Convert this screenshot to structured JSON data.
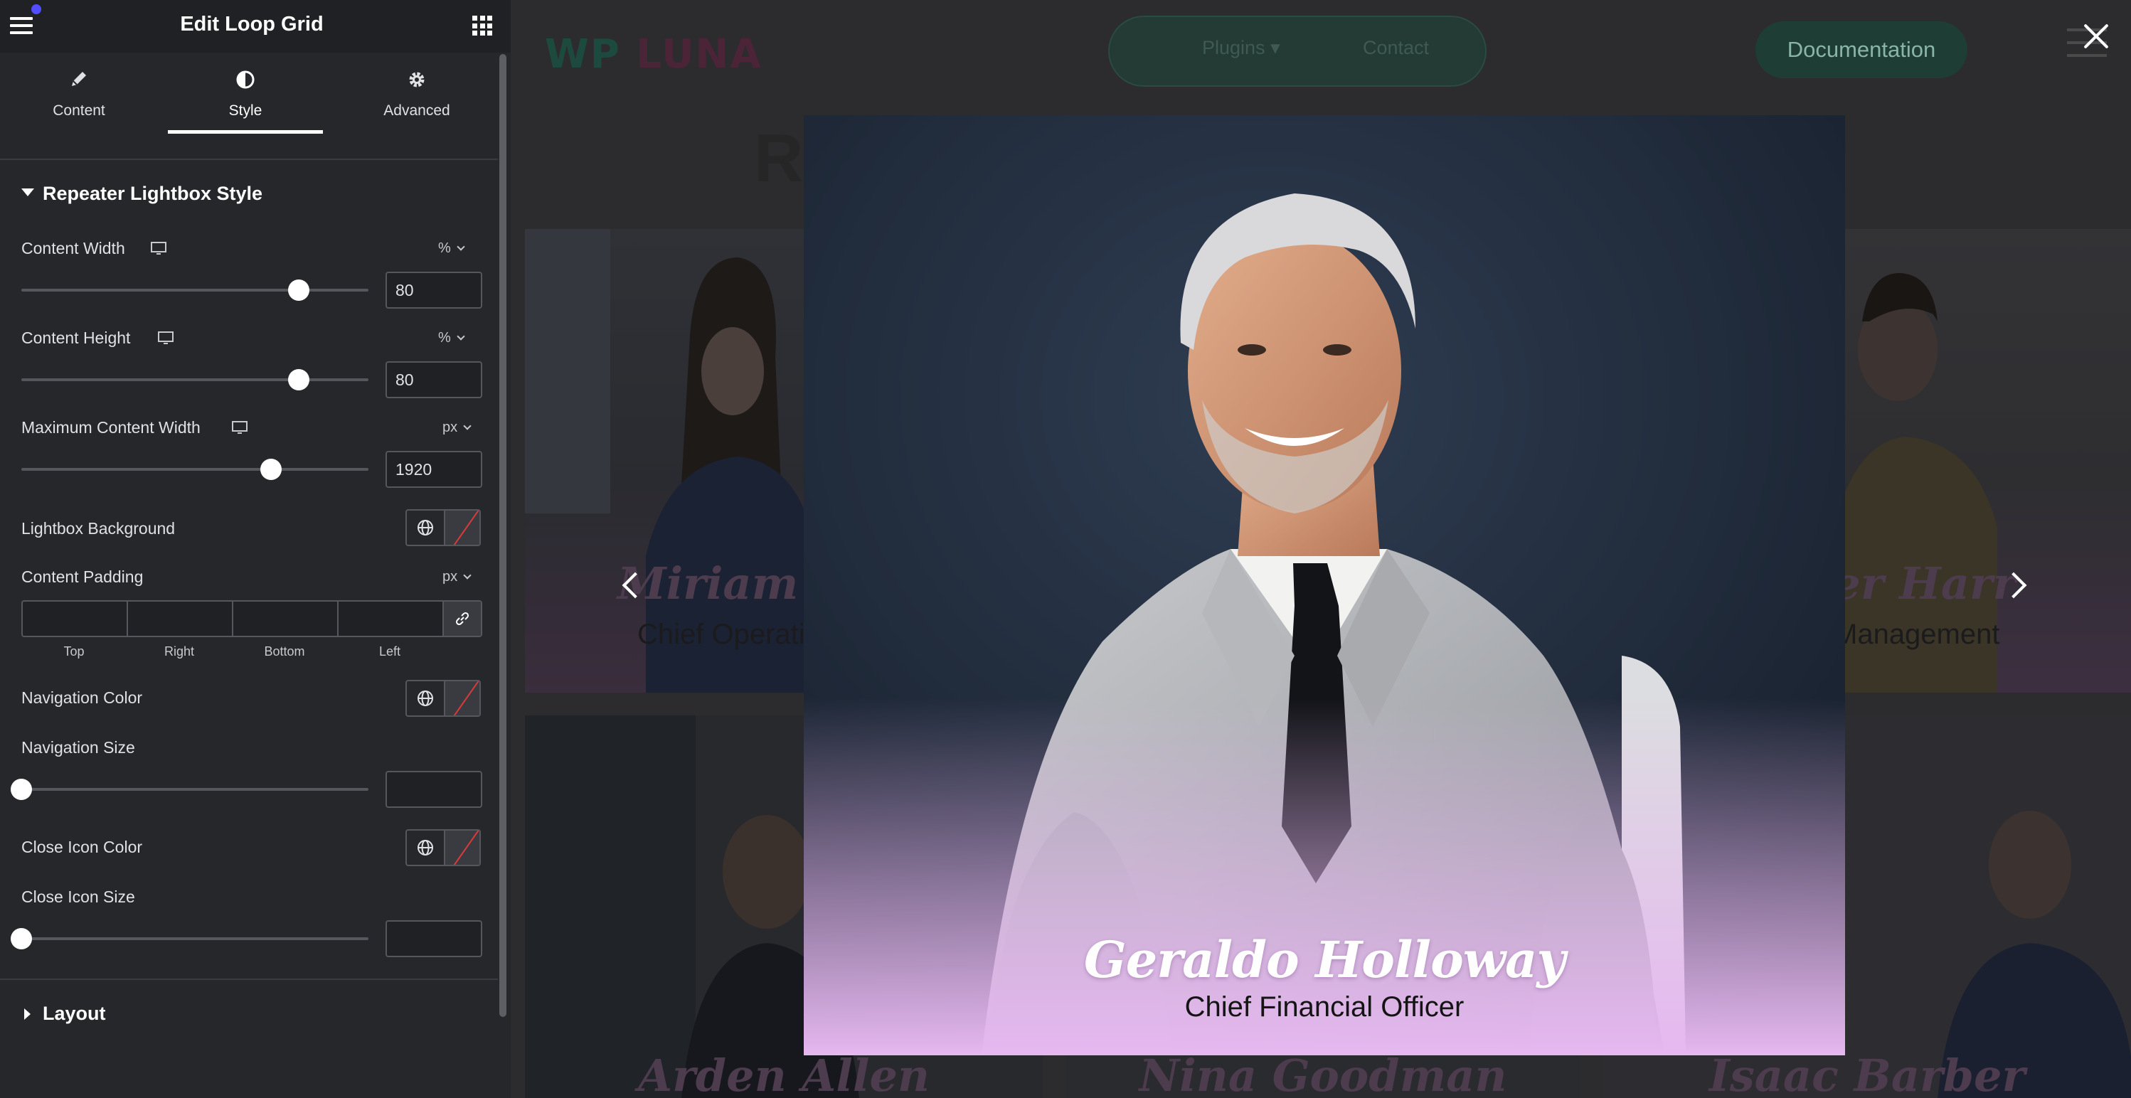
{
  "panel": {
    "title": "Edit Loop Grid",
    "tabs": [
      {
        "label": "Content",
        "icon": "pencil-icon"
      },
      {
        "label": "Style",
        "icon": "contrast-icon"
      },
      {
        "label": "Advanced",
        "icon": "gear-icon"
      }
    ],
    "active_tab": "Style",
    "section_title": "Repeater Lightbox Style",
    "controls": {
      "content_width": {
        "label": "Content Width",
        "unit": "%",
        "value": "80",
        "slider_fraction": 0.8
      },
      "content_height": {
        "label": "Content Height",
        "unit": "%",
        "value": "80",
        "slider_fraction": 0.8
      },
      "max_content_width": {
        "label": "Maximum Content Width",
        "unit": "px",
        "value": "1920",
        "slider_fraction": 0.72
      },
      "lightbox_background": {
        "label": "Lightbox Background"
      },
      "content_padding": {
        "label": "Content Padding",
        "unit": "px",
        "sides": [
          "Top",
          "Right",
          "Bottom",
          "Left"
        ],
        "values": [
          "",
          "",
          "",
          ""
        ]
      },
      "navigation_color": {
        "label": "Navigation Color"
      },
      "navigation_size": {
        "label": "Navigation Size",
        "value": "",
        "slider_fraction": 0
      },
      "close_icon_color": {
        "label": "Close Icon Color"
      },
      "close_icon_size": {
        "label": "Close Icon Size",
        "value": "",
        "slider_fraction": 0
      }
    },
    "layout_section": "Layout"
  },
  "page": {
    "logo": {
      "part1": "WP",
      "part2": "LUNA"
    },
    "nav": [
      "Plugins",
      "Contact"
    ],
    "doc_button": "Documentation",
    "heading_fragment": "Re",
    "cards": [
      {
        "name": "Miriam Pe",
        "role": "Chief Operati"
      },
      {
        "name": "nder Harr",
        "role": "Management"
      },
      {
        "name": "Arden Allen",
        "role": ""
      },
      {
        "name": "Nina Goodman",
        "role": ""
      },
      {
        "name": "Isaac Barber",
        "role": ""
      }
    ]
  },
  "lightbox": {
    "name": "Geraldo Holloway",
    "role": "Chief Financial Officer"
  },
  "colors": {
    "panel_bg": "#26272b",
    "panel_header": "#1f2124",
    "overlay": "#1a1a1e",
    "gradient_pink": "#e6b8f0"
  }
}
